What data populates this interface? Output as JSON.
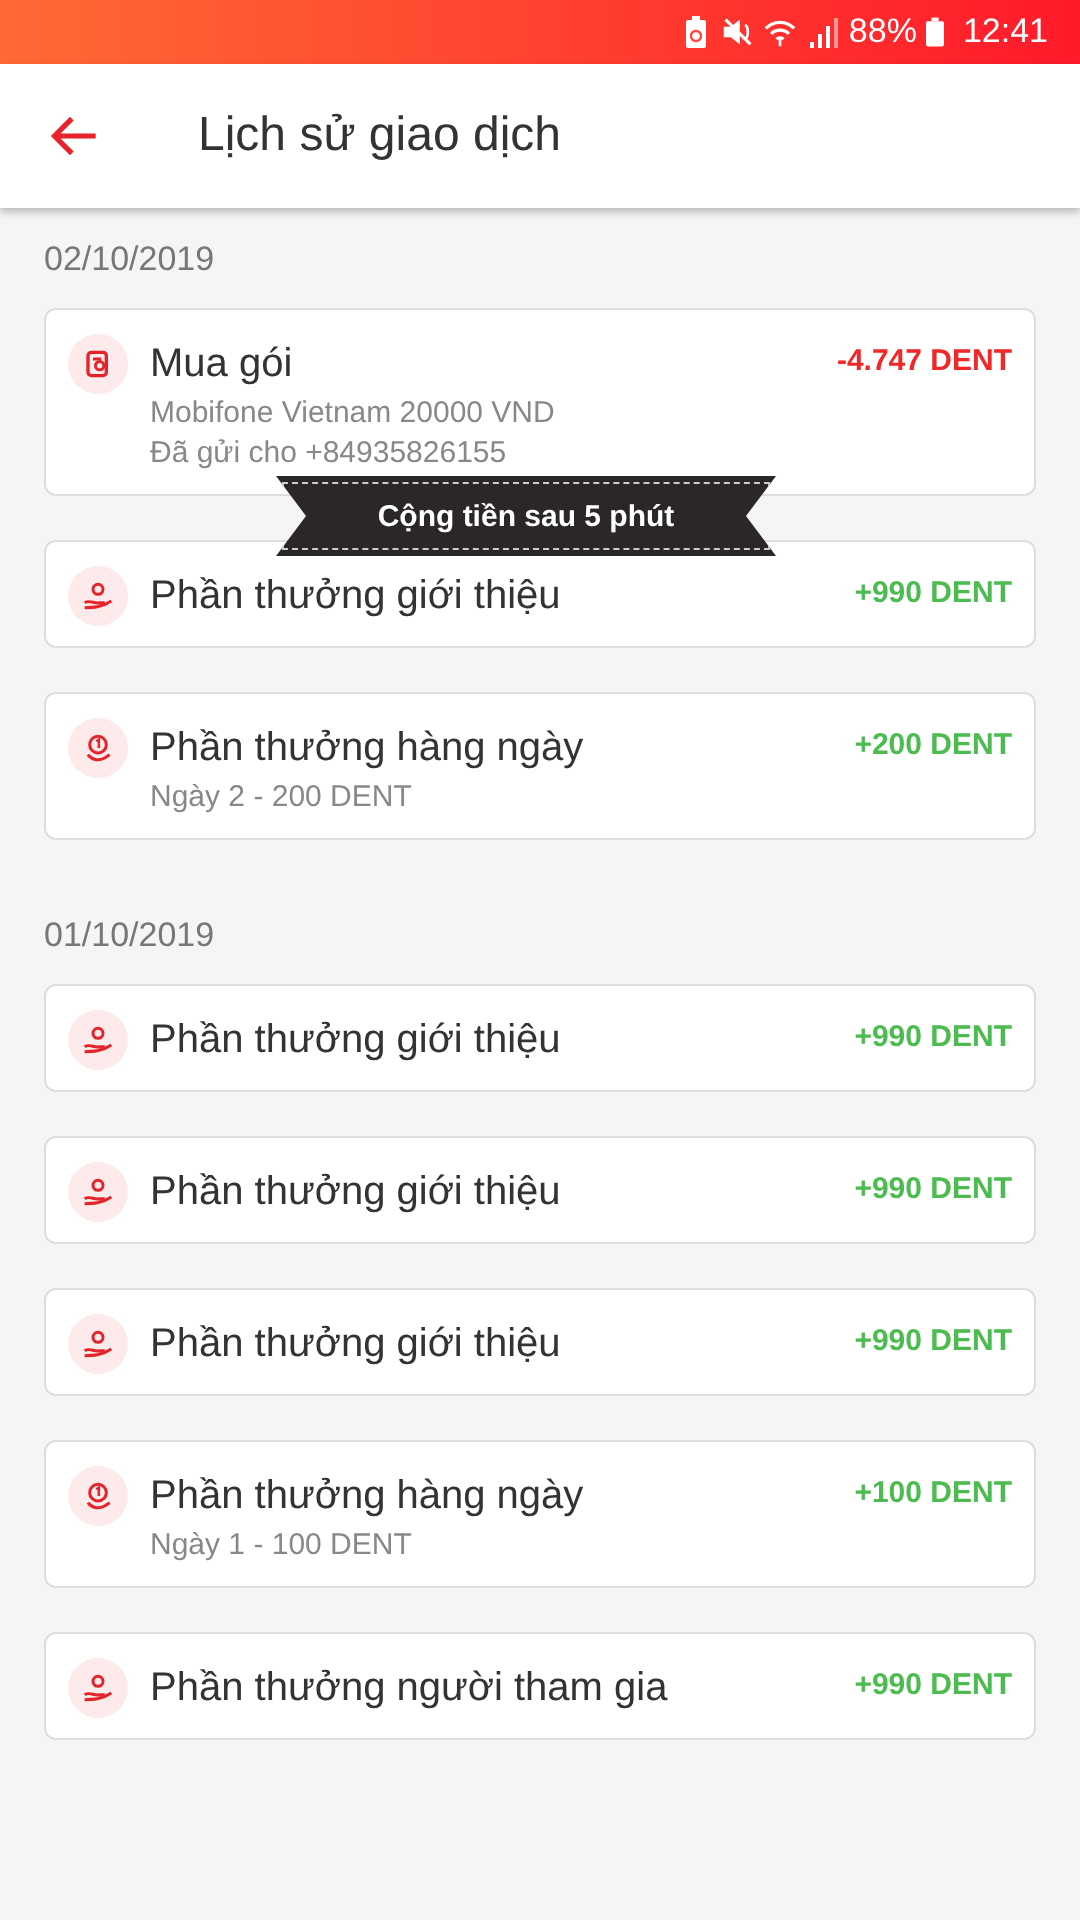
{
  "status_bar": {
    "battery": "88%",
    "time": "12:41"
  },
  "app_bar": {
    "title": "Lịch sử giao dịch"
  },
  "sections": [
    {
      "date": "02/10/2019",
      "transactions": [
        {
          "kind": "purchase",
          "color": "#f02828",
          "title": "Mua gói",
          "details": [
            "Mobifone Vietnam 20000 VND",
            "Đã gửi cho +84935826155"
          ],
          "amount": "-4.747 DENT"
        },
        {
          "kind": "referral",
          "color": "#4cbc50",
          "title": "Phần thưởng giới thiệu",
          "amount": "+990 DENT"
        },
        {
          "kind": "daily",
          "color": "#4cbc50",
          "title": "Phần thưởng hàng ngày",
          "details": [
            "Ngày 2 - 200 DENT"
          ],
          "amount": "+200 DENT"
        }
      ]
    },
    {
      "date": "01/10/2019",
      "transactions": [
        {
          "kind": "referral",
          "color": "#4cbc50",
          "title": "Phần thưởng giới thiệu",
          "amount": "+990 DENT"
        },
        {
          "kind": "referral",
          "color": "#4cbc50",
          "title": "Phần thưởng giới thiệu",
          "amount": "+990 DENT"
        },
        {
          "kind": "referral",
          "color": "#4cbc50",
          "title": "Phần thưởng giới thiệu",
          "amount": "+990 DENT"
        },
        {
          "kind": "daily",
          "color": "#4cbc50",
          "title": "Phần thưởng hàng ngày",
          "details": [
            "Ngày 1 - 100 DENT"
          ],
          "amount": "+100 DENT"
        },
        {
          "kind": "referral",
          "color": "#4cbc50",
          "title": "Phần thưởng người tham gia",
          "amount": "+990 DENT"
        }
      ]
    }
  ],
  "toast": {
    "text": "Cộng tiền sau 5 phút"
  }
}
